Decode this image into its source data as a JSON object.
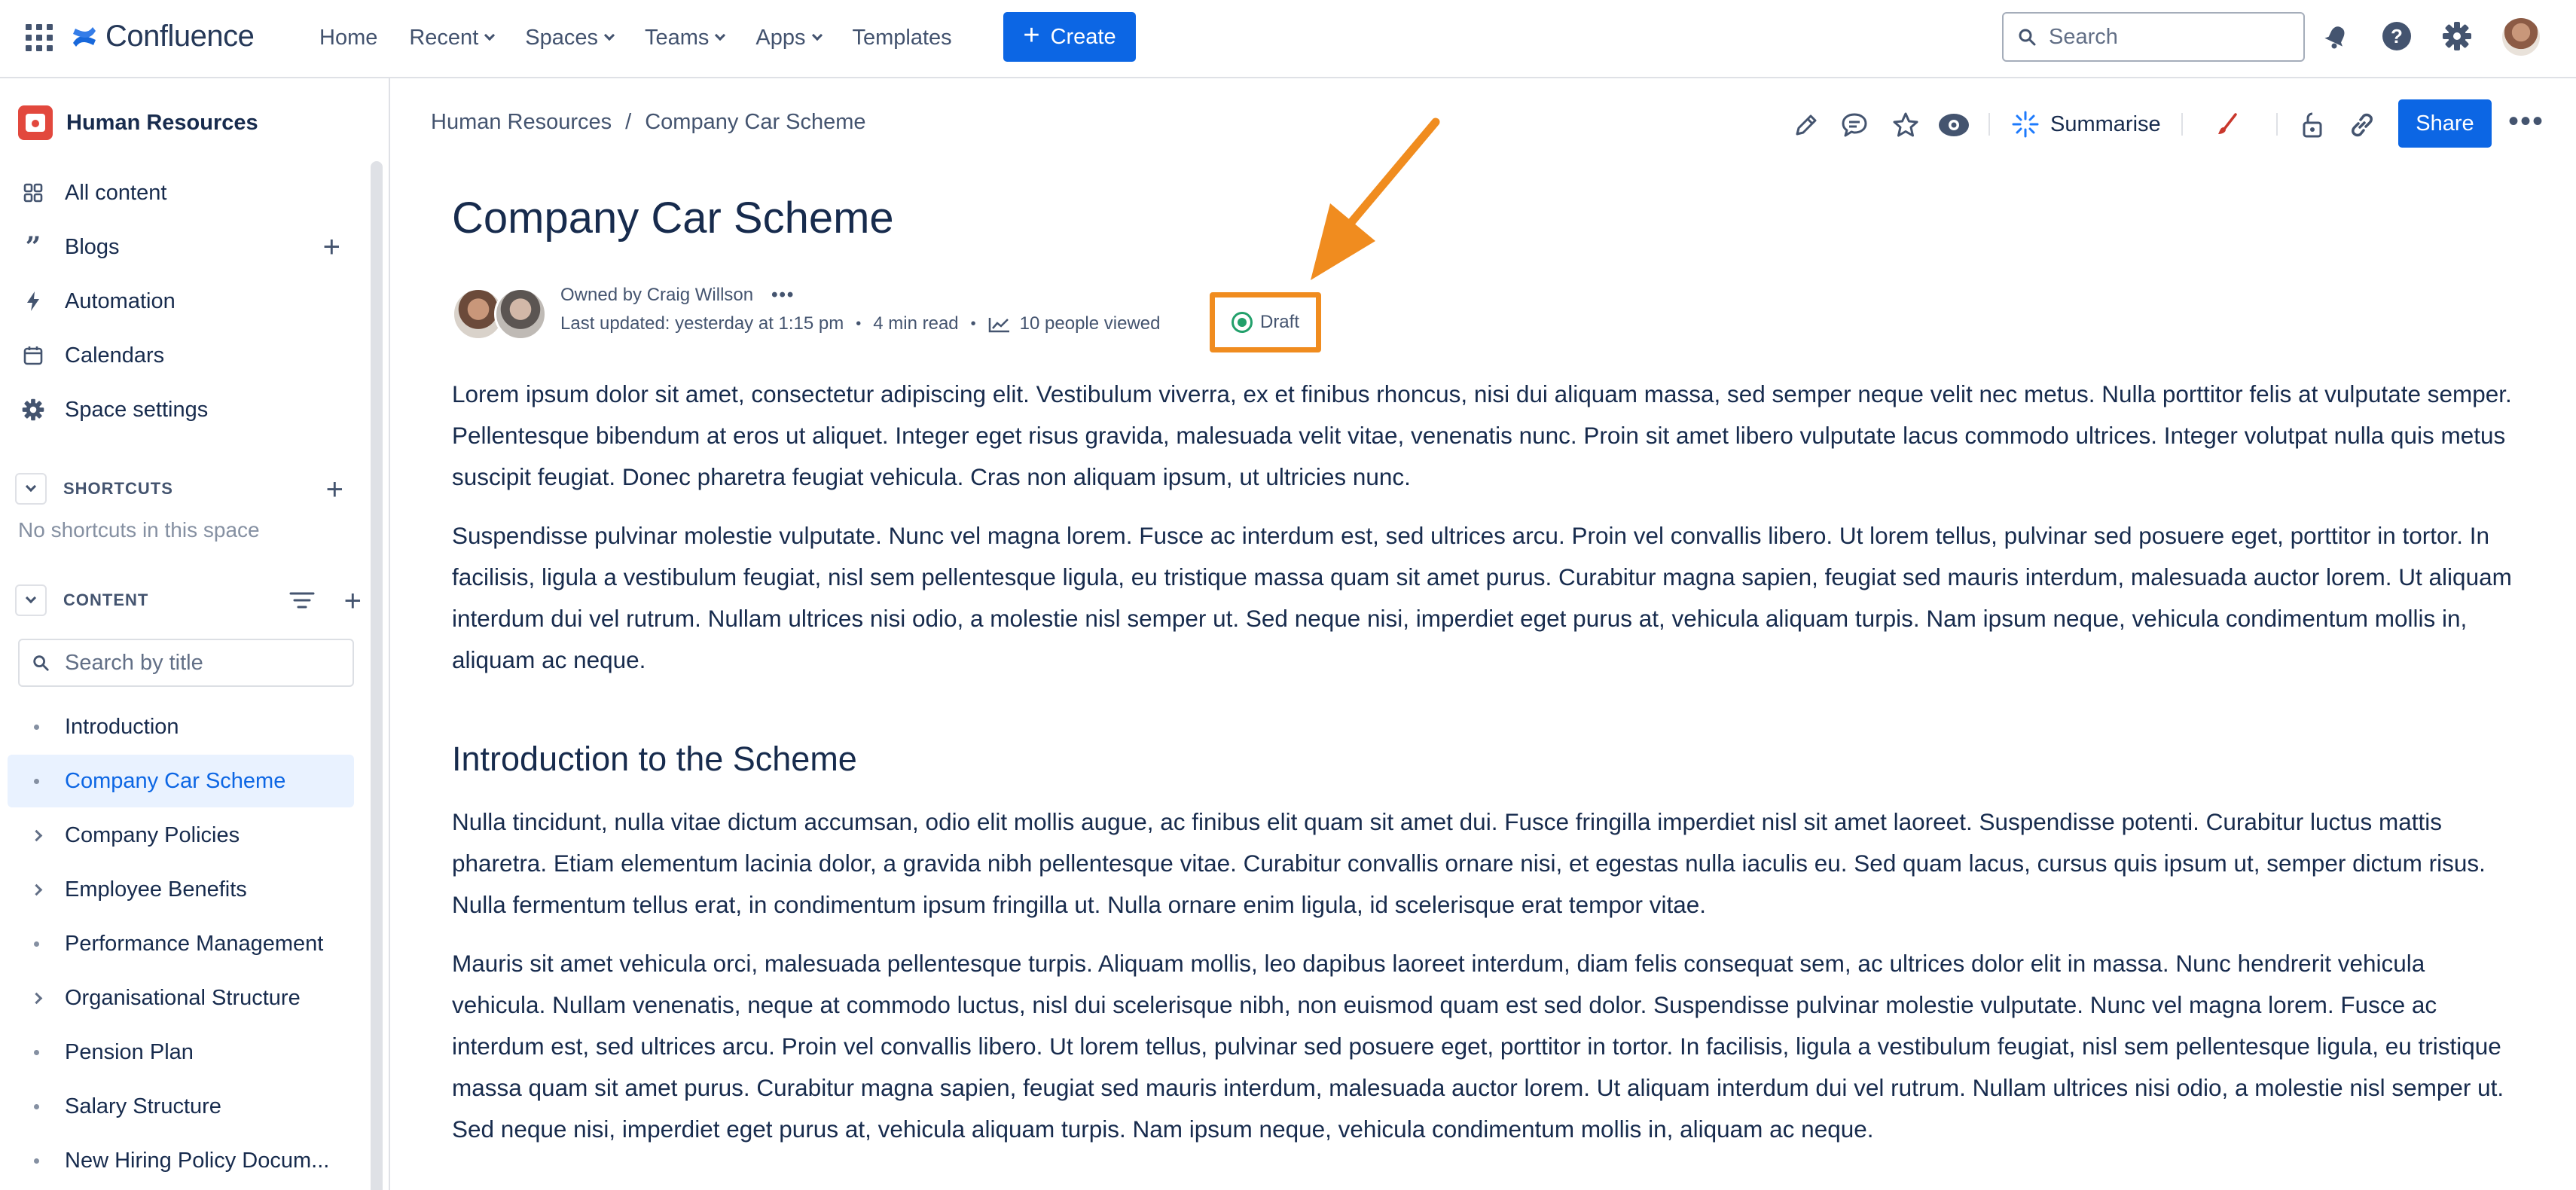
{
  "app": {
    "name": "Confluence"
  },
  "topnav": {
    "links": [
      {
        "label": "Home",
        "dropdown": false
      },
      {
        "label": "Recent",
        "dropdown": true
      },
      {
        "label": "Spaces",
        "dropdown": true
      },
      {
        "label": "Teams",
        "dropdown": true
      },
      {
        "label": "Apps",
        "dropdown": true
      },
      {
        "label": "Templates",
        "dropdown": false
      }
    ],
    "create_label": "Create",
    "search_placeholder": "Search",
    "icons": [
      "notifications-icon",
      "help-icon",
      "settings-icon",
      "profile-avatar"
    ]
  },
  "sidebar": {
    "space_name": "Human Resources",
    "items": [
      {
        "label": "All content",
        "icon": "all-content-icon"
      },
      {
        "label": "Blogs",
        "icon": "quote-icon"
      },
      {
        "label": "Automation",
        "icon": "lightning-icon"
      },
      {
        "label": "Calendars",
        "icon": "calendar-icon"
      },
      {
        "label": "Space settings",
        "icon": "gear-icon"
      }
    ],
    "shortcuts": {
      "label": "SHORTCUTS",
      "empty": "No shortcuts in this space"
    },
    "content": {
      "label": "CONTENT",
      "search_placeholder": "Search by title",
      "tree": [
        {
          "label": "Introduction",
          "expandable": false,
          "selected": false
        },
        {
          "label": "Company Car Scheme",
          "expandable": false,
          "selected": true
        },
        {
          "label": "Company Policies",
          "expandable": true,
          "selected": false
        },
        {
          "label": "Employee Benefits",
          "expandable": true,
          "selected": false
        },
        {
          "label": "Performance Management",
          "expandable": false,
          "selected": false
        },
        {
          "label": "Organisational Structure",
          "expandable": true,
          "selected": false
        },
        {
          "label": "Pension Plan",
          "expandable": false,
          "selected": false
        },
        {
          "label": "Salary Structure",
          "expandable": false,
          "selected": false
        },
        {
          "label": "New Hiring Policy Docum...",
          "expandable": false,
          "selected": false
        }
      ]
    }
  },
  "breadcrumb": {
    "space": "Human Resources",
    "separator": "/",
    "page": "Company Car Scheme"
  },
  "toolbar": {
    "summarise_label": "Summarise",
    "share_label": "Share"
  },
  "page": {
    "title": "Company Car Scheme",
    "owned_by": "Owned by Craig Willson",
    "last_updated": "Last updated: yesterday at 1:15 pm",
    "read_time": "4 min read",
    "views": "10 people viewed",
    "status": "Draft",
    "paragraphs": [
      "Lorem ipsum dolor sit amet, consectetur adipiscing elit. Vestibulum viverra, ex et finibus rhoncus, nisi dui aliquam massa, sed semper neque velit nec metus. Nulla porttitor felis at vulputate semper. Pellentesque bibendum at eros ut aliquet. Integer eget risus gravida, malesuada velit vitae, venenatis nunc. Proin sit amet libero vulputate lacus commodo ultrices. Integer volutpat nulla quis metus suscipit feugiat. Donec pharetra feugiat vehicula. Cras non aliquam ipsum, ut ultricies nunc.",
      "Suspendisse pulvinar molestie vulputate. Nunc vel magna lorem. Fusce ac interdum est, sed ultrices arcu. Proin vel convallis libero. Ut lorem tellus, pulvinar sed posuere eget, porttitor in tortor. In facilisis, ligula a vestibulum feugiat, nisl sem pellentesque ligula, eu tristique massa quam sit amet purus. Curabitur magna sapien, feugiat sed mauris interdum, malesuada auctor lorem. Ut aliquam interdum dui vel rutrum. Nullam ultrices nisi odio, a molestie nisl semper ut. Sed neque nisi, imperdiet eget purus at, vehicula aliquam turpis. Nam ipsum neque, vehicula condimentum mollis in, aliquam ac neque."
    ],
    "section_heading": "Introduction to the Scheme",
    "section_paragraphs": [
      "Nulla tincidunt, nulla vitae dictum accumsan, odio elit mollis augue, ac finibus elit quam sit amet dui. Fusce fringilla imperdiet nisl sit amet laoreet. Suspendisse potenti. Curabitur luctus mattis pharetra. Etiam elementum lacinia dolor, a gravida nibh pellentesque vitae. Curabitur convallis ornare nisi, et egestas nulla iaculis eu. Sed quam lacus, cursus quis ipsum ut, semper dictum risus. Nulla fermentum tellus erat, in condimentum ipsum fringilla ut. Nulla ornare enim ligula, id scelerisque erat tempor vitae.",
      "Mauris sit amet vehicula orci, malesuada pellentesque turpis. Aliquam mollis, leo dapibus laoreet interdum, diam felis consequat sem, ac ultrices dolor elit in massa. Nunc hendrerit vehicula vehicula. Nullam venenatis, neque at commodo luctus, nisl dui scelerisque nibh, non euismod quam est sed dolor. Suspendisse pulvinar molestie vulputate. Nunc vel magna lorem. Fusce ac interdum est, sed ultrices arcu. Proin vel convallis libero. Ut lorem tellus, pulvinar sed posuere eget, porttitor in tortor. In facilisis, ligula a vestibulum feugiat, nisl sem pellentesque ligula, eu tristique massa quam sit amet purus. Curabitur magna sapien, feugiat sed mauris interdum, malesuada auctor lorem. Ut aliquam interdum dui vel rutrum. Nullam ultrices nisi odio, a molestie nisl semper ut. Sed neque nisi, imperdiet eget purus at, vehicula aliquam turpis. Nam ipsum neque, vehicula condimentum mollis in, aliquam ac neque."
    ]
  },
  "colors": {
    "primary": "#0C66E4",
    "annotation": "#F08C1F",
    "status_green": "#22A06B",
    "selected_bg": "#E9F2FF"
  }
}
